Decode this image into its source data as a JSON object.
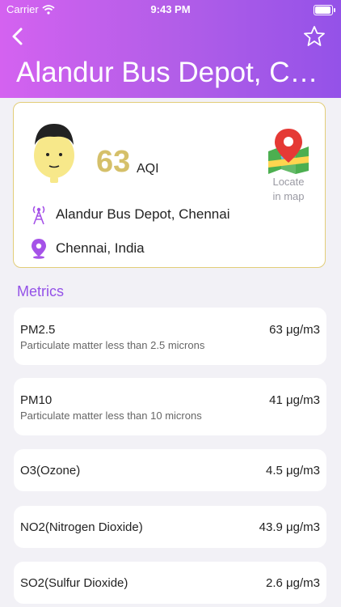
{
  "status_bar": {
    "carrier": "Carrier",
    "time": "9:43 PM"
  },
  "header": {
    "title": "Alandur Bus Depot, Ch...",
    "gradient": [
      "#d462f0",
      "#9452e8"
    ]
  },
  "station": {
    "aqi_value": "63",
    "aqi_unit": "AQI",
    "aqi_color": "#d5c06a",
    "locate_label_line1": "Locate",
    "locate_label_line2": "in map",
    "station_name": "Alandur Bus Depot, Chennai",
    "city": "Chennai, India"
  },
  "metrics": {
    "section_title": "Metrics",
    "items": [
      {
        "name": "PM2.5",
        "description": "Particulate matter less than 2.5 microns",
        "value": "63 μg/m3"
      },
      {
        "name": "PM10",
        "description": "Particulate matter less than 10 microns",
        "value": "41 μg/m3"
      },
      {
        "name": "O3(Ozone)",
        "description": "",
        "value": "4.5 μg/m3"
      },
      {
        "name": "NO2(Nitrogen Dioxide)",
        "description": "",
        "value": "43.9 μg/m3"
      },
      {
        "name": "SO2(Sulfur Dioxide)",
        "description": "",
        "value": "2.6 μg/m3"
      }
    ]
  }
}
